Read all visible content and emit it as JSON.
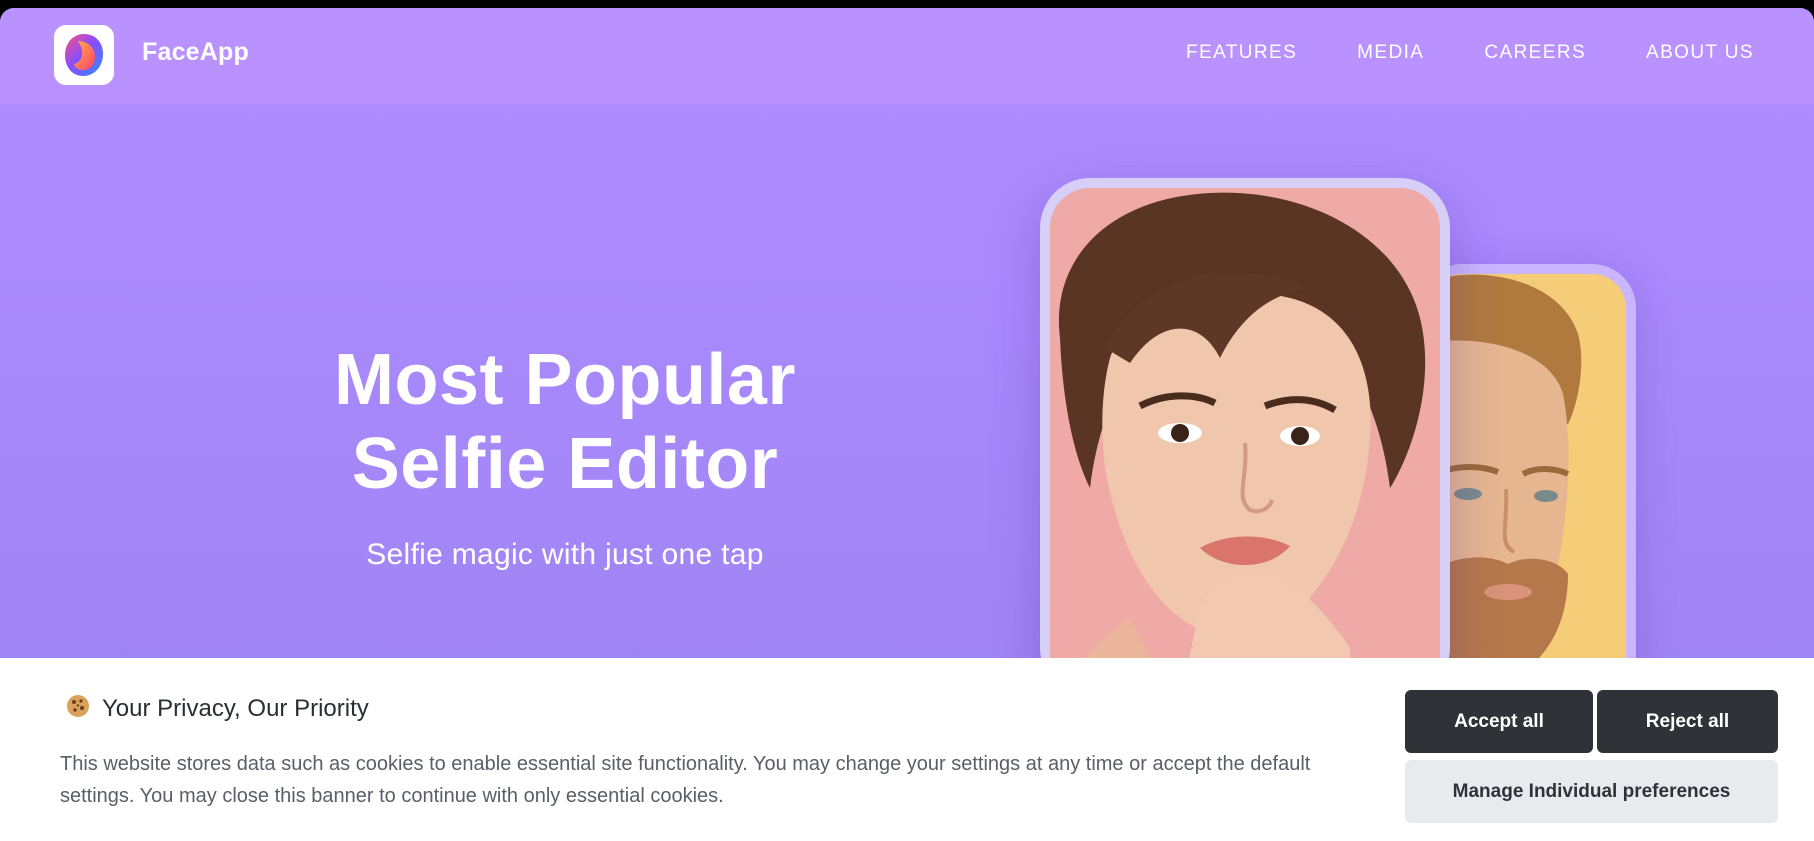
{
  "header": {
    "brand": "FaceApp",
    "nav": [
      "FEATURES",
      "MEDIA",
      "CAREERS",
      "ABOUT US"
    ],
    "logo_icon": "faceapp-logo-icon"
  },
  "hero": {
    "title_line1": "Most Popular",
    "title_line2": "Selfie Editor",
    "subtitle": "Selfie magic with just one tap"
  },
  "cookie_banner": {
    "icon": "cookie-icon",
    "title": "Your Privacy, Our Priority",
    "text": "This website stores data such as cookies to enable essential site functionality. You may change your settings at any time or accept the default settings. You may close this banner to continue with only essential cookies.",
    "accept_label": "Accept all",
    "reject_label": "Reject all",
    "manage_label": "Manage Individual preferences"
  },
  "colors": {
    "header_bg": "#ba92ff",
    "hero_bg": "#a889fb",
    "button_dark": "#2f3237",
    "button_light": "#e8ebee"
  }
}
